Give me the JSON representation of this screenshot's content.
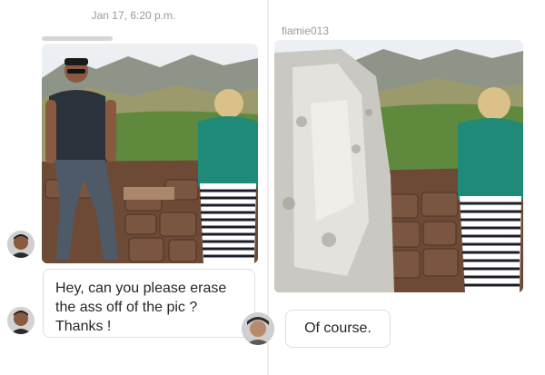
{
  "left_panel": {
    "timestamp": "Jan 17, 6:20 p.m.",
    "message": {
      "lines": [
        "Hey, can you please erase",
        "the ass off of the pic ?",
        "Thanks !"
      ]
    }
  },
  "right_panel": {
    "sender": "fiamie013",
    "reply": "Of course."
  }
}
